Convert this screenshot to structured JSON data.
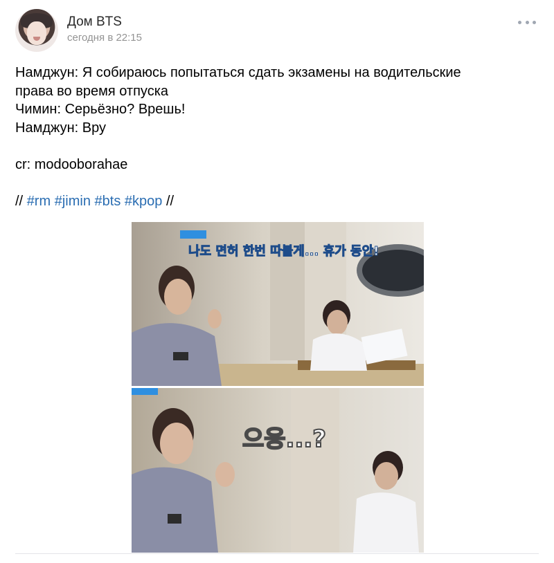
{
  "post": {
    "author": "Дом BTS",
    "time": "сегодня в 22:15",
    "lines": [
      "Намджун: Я собираюсь попытаться сдать экзамены на водительские",
      "права во время отпуска",
      "Чимин: Серьёзно? Врешь!",
      "Намджун: Вру",
      "cr: modooborahae"
    ],
    "hashtag_prefix": "//",
    "hashtag_suffix": "//",
    "hashtags": [
      "#rm",
      "#jimin",
      "#bts",
      "#kpop"
    ]
  },
  "images": {
    "top_caption": "나도 면허 한번 따볼게... 휴가 동안!",
    "bottom_caption": "으응...?"
  },
  "icons": {
    "more": "more-dots-icon"
  },
  "colors": {
    "link": "#2a6db2",
    "meta": "#939393",
    "text": "#000000"
  }
}
